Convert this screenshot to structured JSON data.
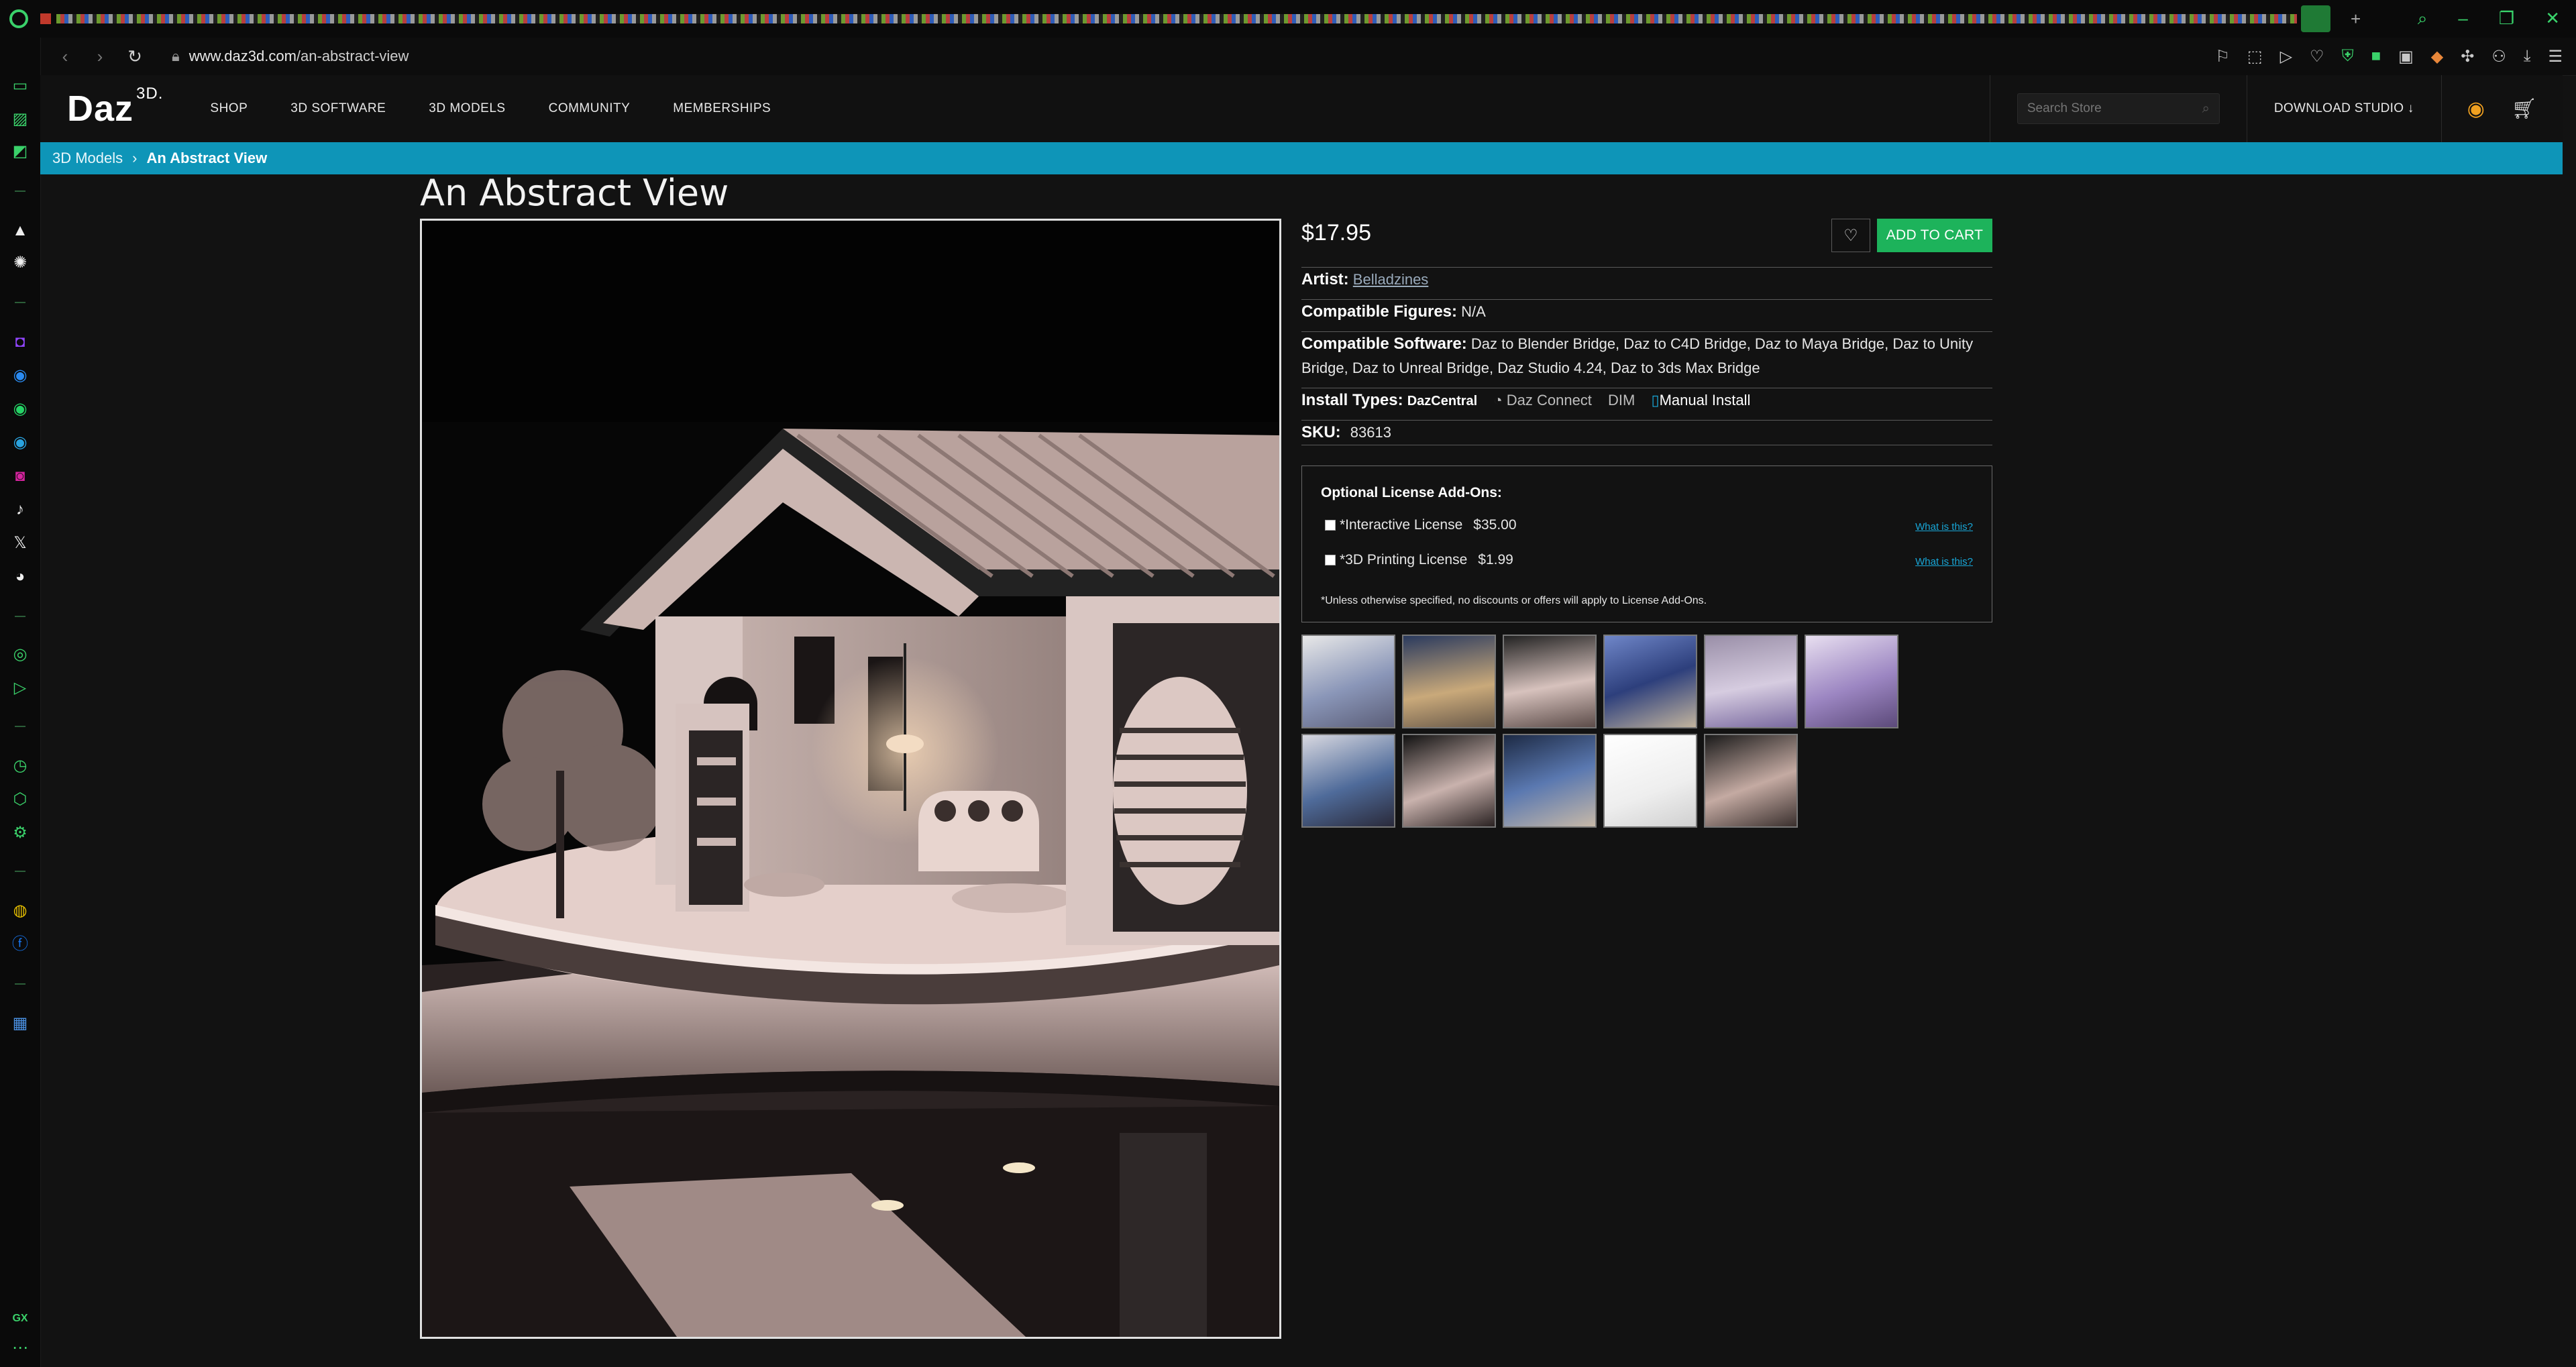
{
  "browser": {
    "url_host": "www.daz3d.com",
    "url_path": "/an-abstract-view",
    "sidebar_bottom_label": "GX"
  },
  "header": {
    "logo_text": "Daz",
    "logo_sup": "3D.",
    "nav": [
      "SHOP",
      "3D SOFTWARE",
      "3D MODELS",
      "COMMUNITY",
      "MEMBERSHIPS"
    ],
    "search_placeholder": "Search Store",
    "download_label": "DOWNLOAD STUDIO"
  },
  "breadcrumb": {
    "parent": "3D Models",
    "separator": "›",
    "current": "An Abstract View"
  },
  "product": {
    "title": "An Abstract View",
    "price": "$17.95",
    "add_to_cart": "ADD TO CART",
    "artist_label": "Artist:",
    "artist": "Belladzines",
    "figures_label": "Compatible Figures:",
    "figures": "N/A",
    "software_label": "Compatible Software:",
    "software_line1": "Daz to Blender Bridge, Daz to C4D Bridge, Daz to Maya Bridge, Daz to Unity",
    "software_line2": "Bridge, Daz to Unreal Bridge, Daz Studio 4.24, Daz to 3ds Max Bridge",
    "install_label": "Install Types:",
    "install_types": [
      "DazCentral",
      "Daz Connect",
      "DIM",
      "Manual Install"
    ],
    "sku_label": "SKU:",
    "sku": "83613"
  },
  "license": {
    "title": "Optional License Add-Ons:",
    "items": [
      {
        "name": "*Interactive License",
        "price": "$35.00",
        "link": "What is this?"
      },
      {
        "name": "*3D Printing License",
        "price": "$1.99",
        "link": "What is this?"
      }
    ],
    "note": "*Unless otherwise specified, no discounts or offers will apply to License Add-Ons."
  },
  "colors": {
    "brand_bar": "#0e95b8",
    "cart_green": "#1db35b",
    "browser_accent": "#3ad16a"
  }
}
